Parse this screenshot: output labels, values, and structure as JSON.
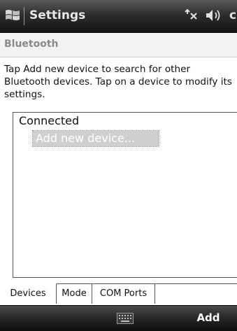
{
  "titlebar": {
    "title": "Settings",
    "clock_fragment": "c",
    "icons": [
      "windows-start-icon",
      "connectivity-icon",
      "volume-icon"
    ]
  },
  "subheader": {
    "title": "Bluetooth"
  },
  "description": "Tap Add new device to search for other Bluetooth devices. Tap on a device to modify its settings.",
  "device_list": {
    "group_label": "Connected",
    "items": [
      {
        "label": "Add new device..."
      }
    ]
  },
  "tabs": [
    {
      "label": "Devices",
      "selected": true
    },
    {
      "label": "Mode",
      "selected": false
    },
    {
      "label": "COM Ports",
      "selected": false
    }
  ],
  "softkeys": {
    "right": "Add",
    "center_icon": "keyboard-icon"
  },
  "colors": {
    "titlebar": "#2e2e2e",
    "subheader_text": "#8a8a8a",
    "highlight": "#cfcfcf"
  }
}
